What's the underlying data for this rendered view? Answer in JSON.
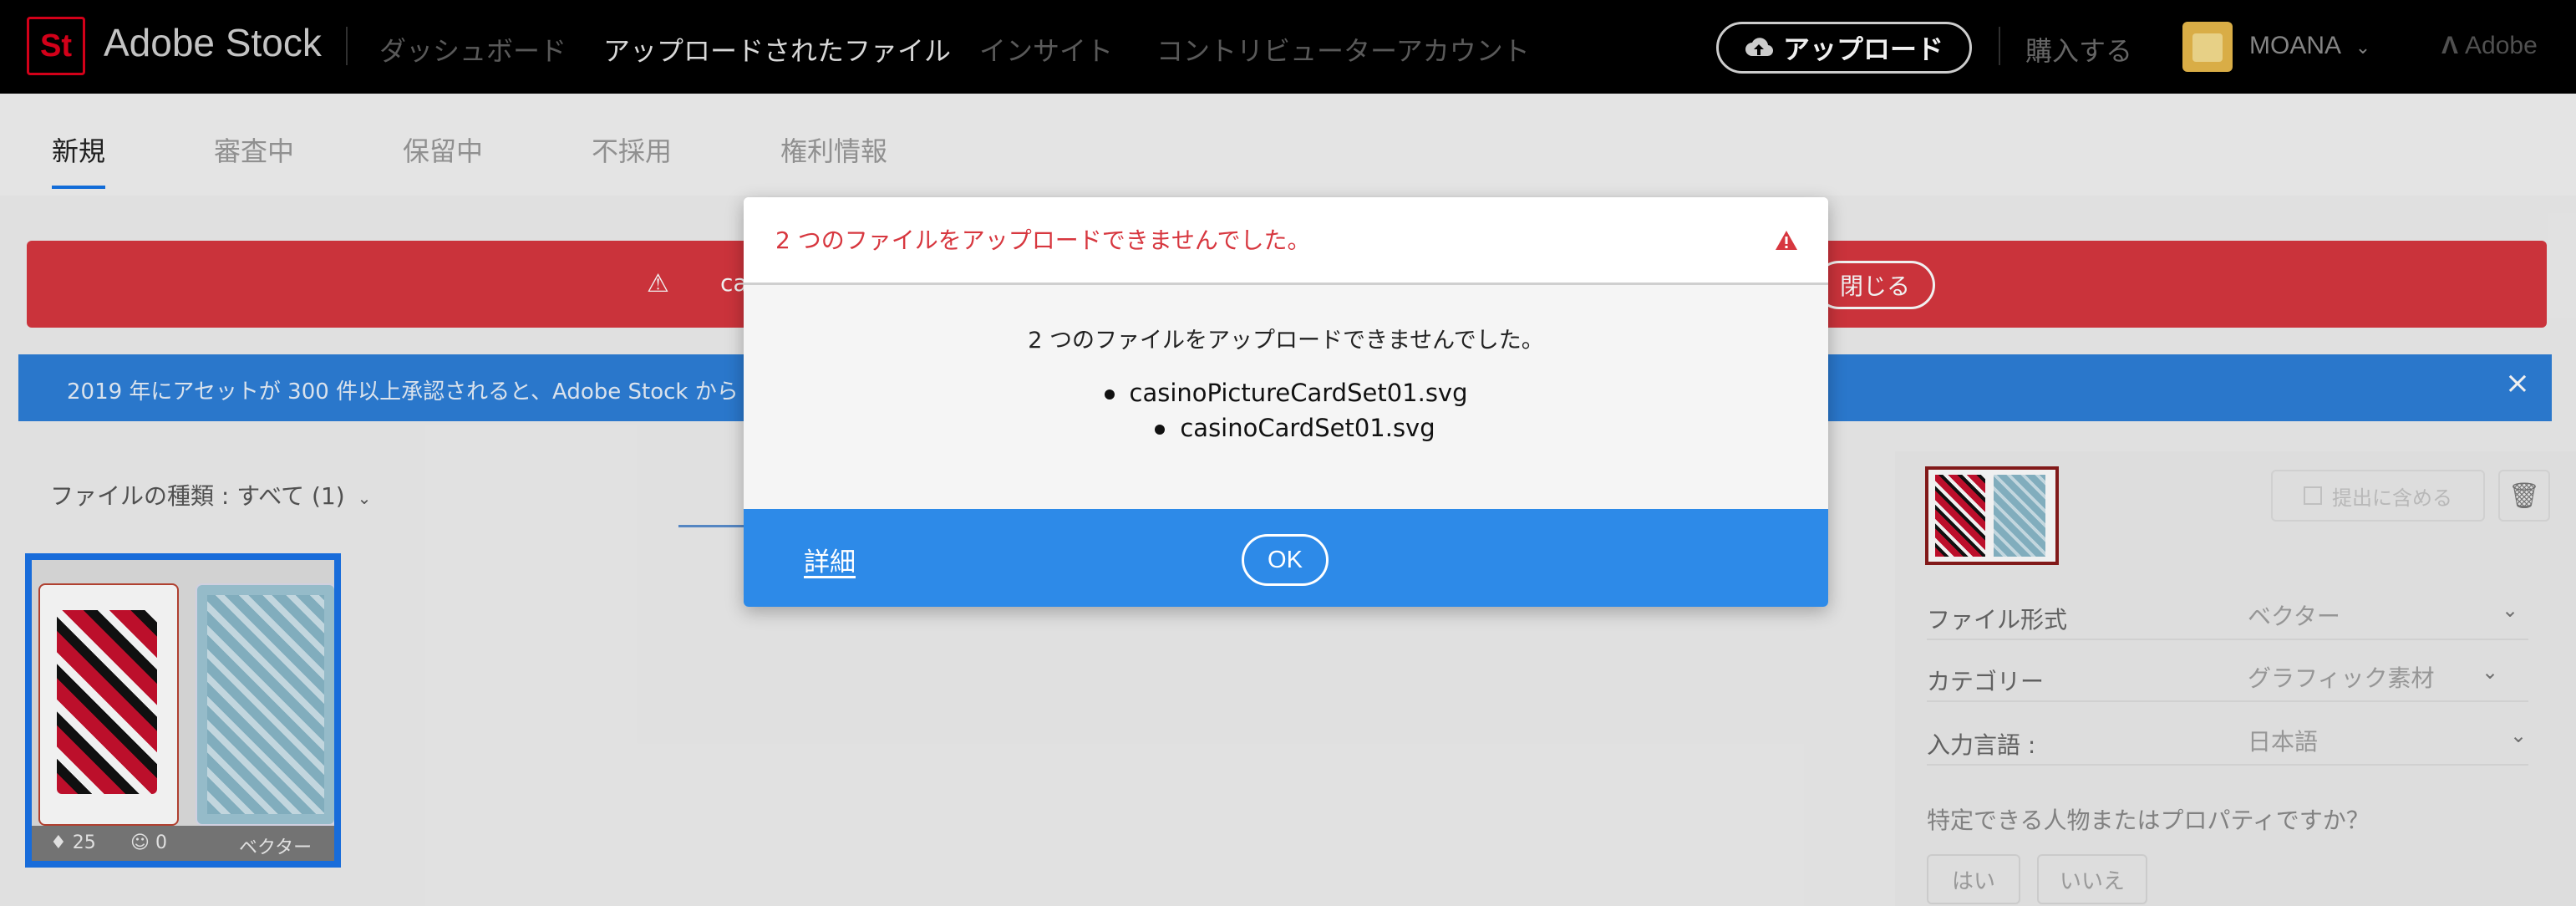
{
  "header": {
    "logo_text": "St",
    "brand": "Adobe Stock",
    "nav": [
      "ダッシュボード",
      "アップロードされたファイル",
      "インサイト",
      "コントリビューターアカウント"
    ],
    "active_nav_index": 1,
    "upload_label": "アップロード",
    "buy_label": "購入する",
    "user_name": "MOANA",
    "adobe_label": "Adobe"
  },
  "tabs": [
    "新規",
    "審査中",
    "保留中",
    "不採用",
    "権利情報"
  ],
  "banners": {
    "error_text_partial": "casin",
    "error_close_label": "閉じる",
    "info_text": "2019 年にアセットが 300 件以上承認されると、Adobe Stock から"
  },
  "filter_label": "ファイルの種類 : すべて (1)",
  "tile": {
    "tag_count": "25",
    "people_count": "0",
    "type_label": "ベクター"
  },
  "side_panel": {
    "include_label": "提出に含める",
    "rows": [
      {
        "label": "ファイル形式",
        "value": "ベクター"
      },
      {
        "label": "カテゴリー",
        "value": "グラフィック素材"
      },
      {
        "label": "入力言語 :",
        "value": "日本語"
      }
    ],
    "question": "特定できる人物またはプロパティですか？",
    "yes_label": "はい",
    "no_label": "いいえ"
  },
  "dialog": {
    "title": "2 つのファイルをアップロードできませんでした。",
    "message": "2 つのファイルをアップロードできませんでした。",
    "files": [
      "casinoPictureCardSet01.svg",
      "casinoCardSet01.svg"
    ],
    "details_label": "詳細",
    "ok_label": "OK"
  },
  "colors": {
    "accent_blue": "#2d8ae8",
    "error_red": "#d7373f",
    "brand_red": "#e0001b"
  }
}
